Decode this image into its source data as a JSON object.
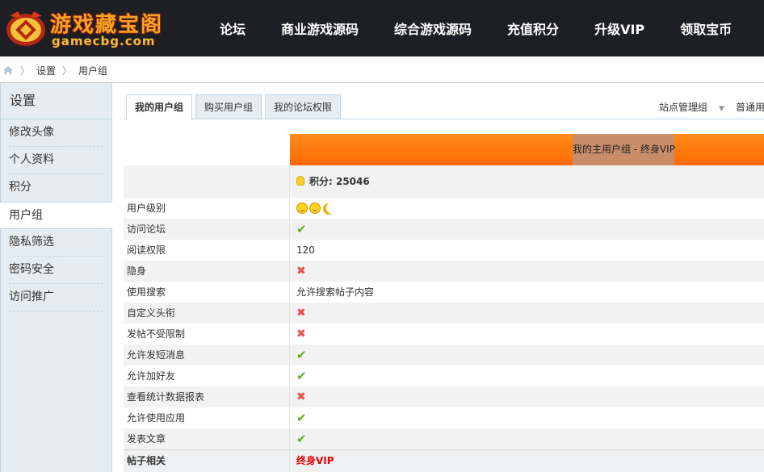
{
  "header": {
    "logo_title": "游戏藏宝阁",
    "logo_sub": "gamecbg.com",
    "nav": [
      "论坛",
      "商业游戏源码",
      "综合游戏源码",
      "充值积分",
      "升级VIP",
      "领取宝币"
    ]
  },
  "breadcrumb": [
    "设置",
    "用户组"
  ],
  "sidebar": {
    "title": "设置",
    "items": [
      "修改头像",
      "个人资料",
      "积分",
      "用户组",
      "隐私筛选",
      "密码安全",
      "访问推广"
    ],
    "active": "用户组"
  },
  "tabs": {
    "items": [
      "我的用户组",
      "购买用户组",
      "我的论坛权限"
    ],
    "right": [
      "站点管理组",
      "普通用"
    ]
  },
  "group": {
    "banner_label": "我的主用户组 - 终身VIP",
    "points": "积分: 25046"
  },
  "rows": [
    {
      "key": "用户级别",
      "type": "level",
      "icon": "level-icons"
    },
    {
      "key": "访问论坛",
      "type": "yes"
    },
    {
      "key": "阅读权限",
      "type": "text",
      "value": "120"
    },
    {
      "key": "隐身",
      "type": "no"
    },
    {
      "key": "使用搜索",
      "type": "text",
      "value": "允许搜索帖子内容"
    },
    {
      "key": "自定义头衔",
      "type": "no"
    },
    {
      "key": "发帖不受限制",
      "type": "no"
    },
    {
      "key": "允许发短消息",
      "type": "yes"
    },
    {
      "key": "允许加好友",
      "type": "yes"
    },
    {
      "key": "查看统计数据报表",
      "type": "no"
    },
    {
      "key": "允许使用应用",
      "type": "yes"
    },
    {
      "key": "发表文章",
      "type": "yes"
    }
  ],
  "section": {
    "key": "帖子相关",
    "value": "终身VIP"
  },
  "colors": {
    "header_bg": "#1d1f24",
    "banner": "#ff7a00",
    "yes": "#5bae1c",
    "no": "#e8534a",
    "highlight": "#e00000"
  }
}
